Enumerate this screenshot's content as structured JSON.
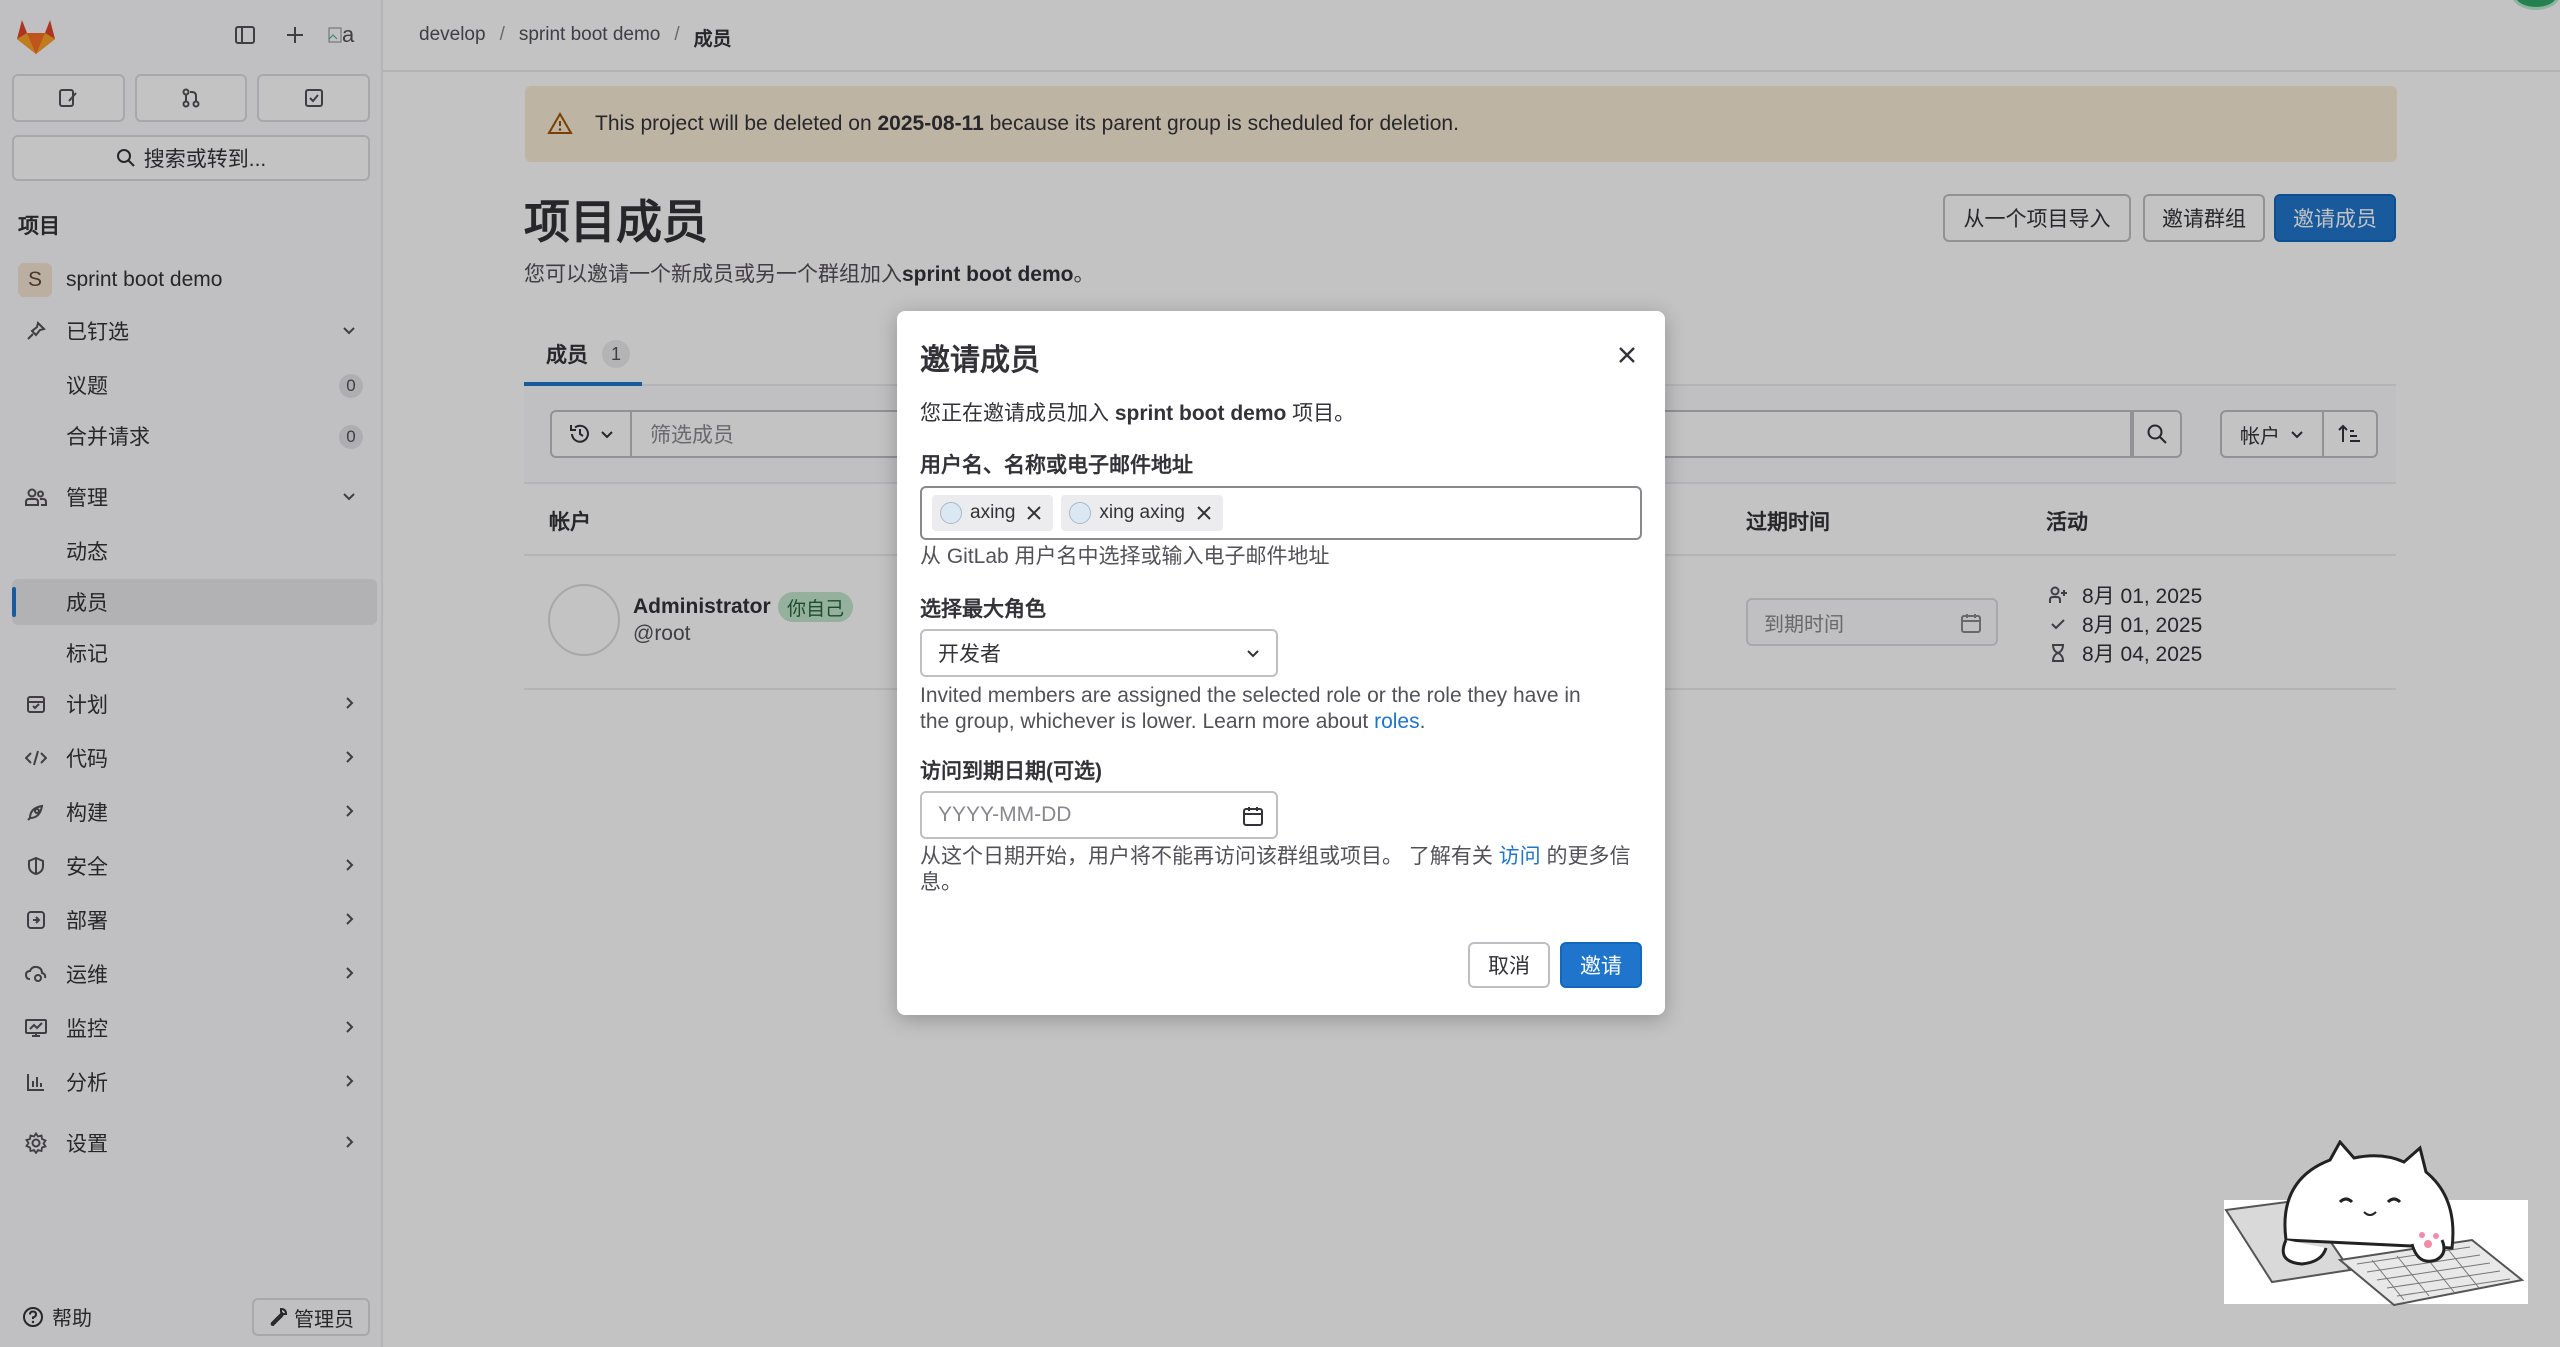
{
  "colors": {
    "accent": "#1f75cb",
    "warning_bg": "#f8ecd7",
    "success_badge": "#c3e6cd"
  },
  "topbar": {
    "breadcrumb": [
      "develop",
      "sprint boot demo",
      "成员"
    ]
  },
  "sidebar": {
    "avatar_alt": "a",
    "search_label": "搜索或转到...",
    "section_title": "项目",
    "project": {
      "initial": "S",
      "name": "sprint boot demo"
    },
    "items": [
      {
        "label": "已钉选",
        "icon": "pin-icon"
      },
      {
        "label": "议题",
        "count": "0"
      },
      {
        "label": "合并请求",
        "count": "0"
      },
      {
        "label": "管理",
        "icon": "users-icon"
      },
      {
        "label": "动态"
      },
      {
        "label": "成员"
      },
      {
        "label": "标记"
      },
      {
        "label": "计划",
        "icon": "calendar-icon"
      },
      {
        "label": "代码",
        "icon": "code-icon"
      },
      {
        "label": "构建",
        "icon": "rocket-icon"
      },
      {
        "label": "安全",
        "icon": "shield-icon"
      },
      {
        "label": "部署",
        "icon": "deploy-icon"
      },
      {
        "label": "运维",
        "icon": "cloud-gear-icon"
      },
      {
        "label": "监控",
        "icon": "monitor-icon"
      },
      {
        "label": "分析",
        "icon": "chart-icon"
      },
      {
        "label": "设置",
        "icon": "settings-icon"
      }
    ],
    "help_label": "帮助",
    "admin_label": "管理员"
  },
  "alert": {
    "prefix": "This project will be deleted on ",
    "date": "2025-08-11",
    "suffix": " because its parent group is scheduled for deletion."
  },
  "page": {
    "title": "项目成员",
    "desc_prefix": "您可以邀请一个新成员或另一个群组加入",
    "desc_project": "sprint boot demo",
    "desc_suffix": "。",
    "buttons": {
      "import": "从一个项目导入",
      "invite_group": "邀请群组",
      "invite_member": "邀请成员"
    }
  },
  "tabs": [
    {
      "label": "成员",
      "count": "1"
    }
  ],
  "filter": {
    "placeholder": "筛选成员",
    "sort_label": "帐户"
  },
  "table": {
    "headers": {
      "account": "帐户",
      "expiry": "过期时间",
      "activity": "活动"
    },
    "rows": [
      {
        "name": "Administrator",
        "badge": "你自己",
        "handle": "@root",
        "expiry_placeholder": "到期时间",
        "activity": [
          "8月 01, 2025",
          "8月 01, 2025",
          "8月 04, 2025"
        ]
      }
    ]
  },
  "modal": {
    "title": "邀请成员",
    "intro_prefix": "您正在邀请成员加入 ",
    "intro_project": "sprint boot demo",
    "intro_suffix": " 项目。",
    "users_label": "用户名、名称或电子邮件地址",
    "tokens": [
      "axing",
      "xing axing"
    ],
    "users_help": "从 GitLab 用户名中选择或输入电子邮件地址",
    "role_label": "选择最大角色",
    "role_value": "开发者",
    "role_help_line1": "Invited members are assigned the selected role or the role they have in",
    "role_help_line2": "the group, whichever is lower. Learn more about ",
    "role_help_link": "roles",
    "role_help_end": ".",
    "expiry_label": "访问到期日期(可选)",
    "expiry_placeholder": "YYYY-MM-DD",
    "expiry_help_prefix": "从这个日期开始，用户将不能再访问该群组或项目。 了解有关 ",
    "expiry_help_link": "访问",
    "expiry_help_suffix": " 的更多信",
    "expiry_help_line2": "息。",
    "cancel_label": "取消",
    "invite_label": "邀请"
  }
}
